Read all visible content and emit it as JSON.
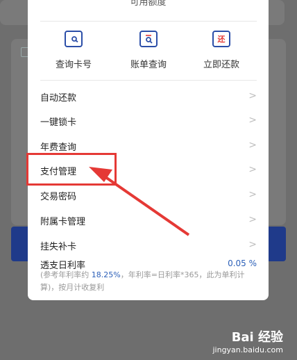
{
  "sheet": {
    "limit_label": "可用额度"
  },
  "quick_actions": [
    {
      "label": "查询卡号",
      "icon": "card-search-icon"
    },
    {
      "label": "账单查询",
      "icon": "bill-search-icon"
    },
    {
      "label": "立即还款",
      "icon": "repay-icon",
      "icon_text": "还"
    }
  ],
  "menu": [
    {
      "label": "自动还款"
    },
    {
      "label": "一键锁卡"
    },
    {
      "label": "年费查询"
    },
    {
      "label": "支付管理"
    },
    {
      "label": "交易密码"
    },
    {
      "label": "附属卡管理"
    },
    {
      "label": "挂失补卡"
    }
  ],
  "rate": {
    "label": "透支日利率",
    "value": "0.05 %",
    "note_prefix": "(参考年利率约 ",
    "note_rate": "18.25%",
    "note_suffix": "，年利率=日利率*365，此为单利计算)，按月计收复利"
  },
  "watermark": {
    "logo": "Bai 经验",
    "url": "jingyan.baidu.com"
  },
  "colors": {
    "accent": "#2b4ea8",
    "annotation": "#e53935"
  }
}
